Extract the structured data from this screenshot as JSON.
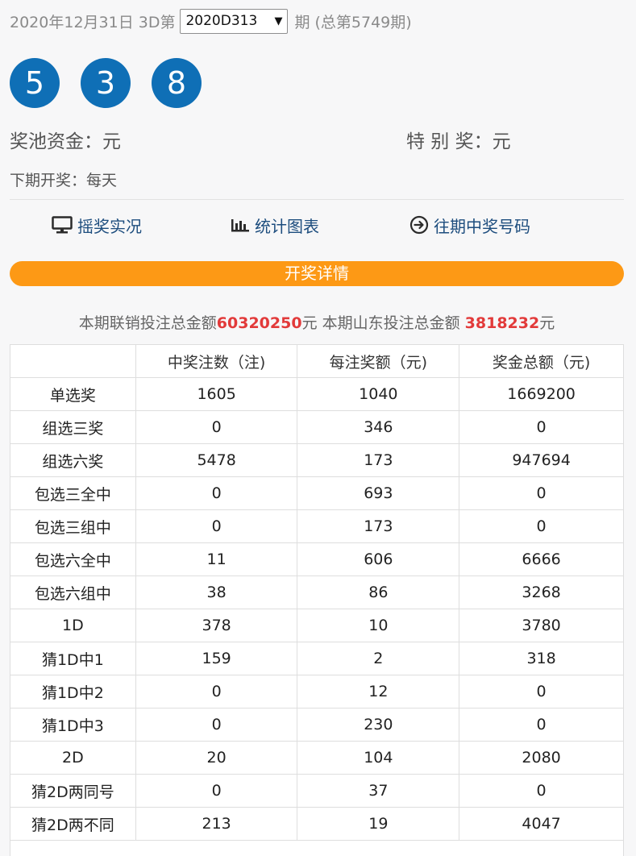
{
  "header": {
    "date_text": "2020年12月31日 3D第",
    "issue_selected": "2020D313",
    "suffix_text": "期 (总第5749期)"
  },
  "balls": [
    "5",
    "3",
    "8"
  ],
  "pool": {
    "left_text": "奖池资金：元",
    "right_text": "特 别 奖：元"
  },
  "next_draw": "下期开奖：每天",
  "nav": [
    {
      "label": "摇奖实况",
      "icon": "monitor-icon"
    },
    {
      "label": "统计图表",
      "icon": "bar-chart-icon"
    },
    {
      "label": "往期中奖号码",
      "icon": "arrow-circle-right-icon"
    }
  ],
  "details_title": "开奖详情",
  "summary": {
    "p1": "本期联销投注总金额",
    "v1": "60320250",
    "p2": "元 本期山东投注总金额 ",
    "v2": "3818232",
    "p3": "元"
  },
  "table": {
    "headers": [
      "",
      "中奖注数（注)",
      "每注奖额（元)",
      "奖金总额（元)"
    ],
    "rows": [
      [
        "单选奖",
        "1605",
        "1040",
        "1669200"
      ],
      [
        "组选三奖",
        "0",
        "346",
        "0"
      ],
      [
        "组选六奖",
        "5478",
        "173",
        "947694"
      ],
      [
        "包选三全中",
        "0",
        "693",
        "0"
      ],
      [
        "包选三组中",
        "0",
        "173",
        "0"
      ],
      [
        "包选六全中",
        "11",
        "606",
        "6666"
      ],
      [
        "包选六组中",
        "38",
        "86",
        "3268"
      ],
      [
        "1D",
        "378",
        "10",
        "3780"
      ],
      [
        "猜1D中1",
        "159",
        "2",
        "318"
      ],
      [
        "猜1D中2",
        "0",
        "12",
        "0"
      ],
      [
        "猜1D中3",
        "0",
        "230",
        "0"
      ],
      [
        "2D",
        "20",
        "104",
        "2080"
      ],
      [
        "猜2D两同号",
        "0",
        "37",
        "0"
      ],
      [
        "猜2D两不同",
        "213",
        "19",
        "4047"
      ]
    ]
  },
  "colors": {
    "ball": "#0f6fb6",
    "accent_orange": "#fd9915",
    "highlight_red": "#e23a3a",
    "link": "#1d4d7e"
  }
}
